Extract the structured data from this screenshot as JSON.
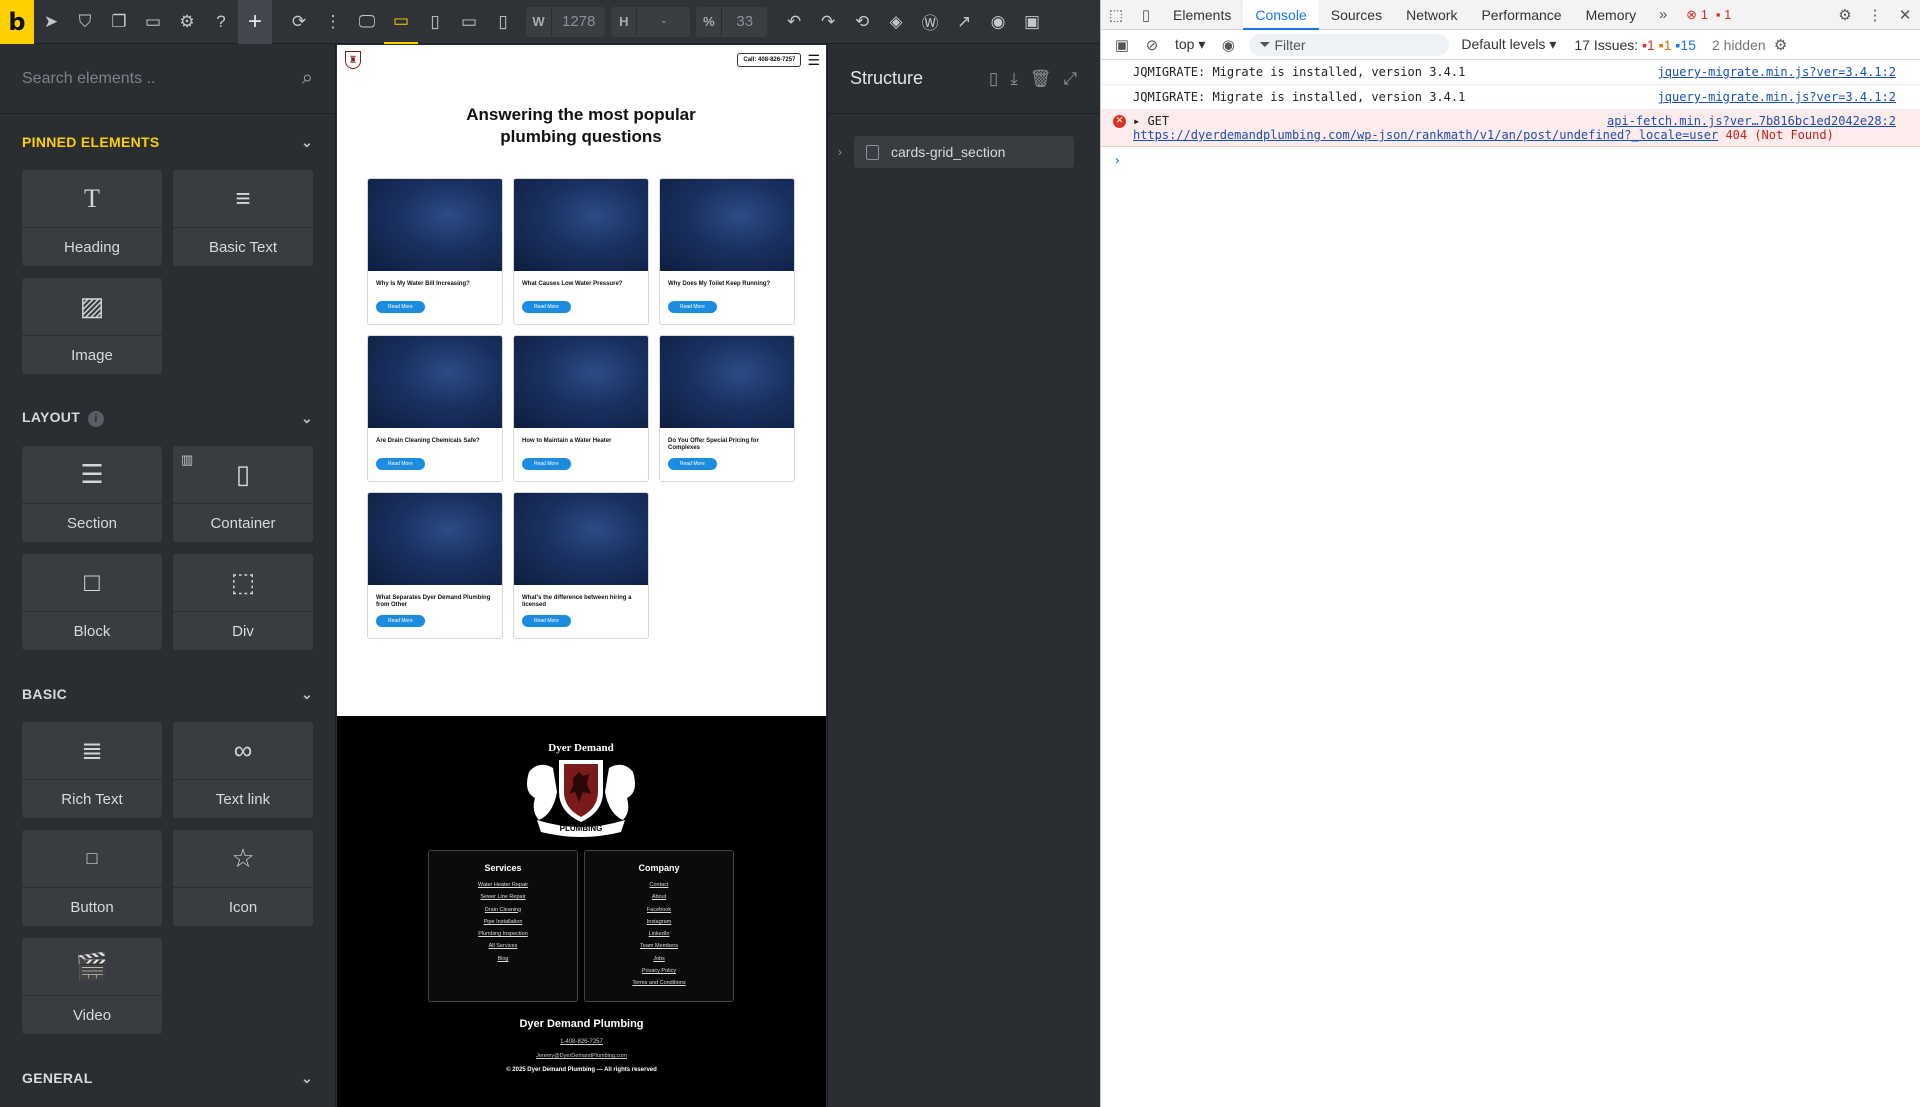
{
  "toolbar": {
    "logo": "b",
    "width_label": "W",
    "width_value": "1278",
    "height_label": "H",
    "height_value": "-",
    "zoom_label": "%",
    "zoom_value": "33"
  },
  "left_panel": {
    "search_placeholder": "Search elements ..",
    "categories": [
      {
        "title": "PINNED ELEMENTS",
        "items": [
          "Heading",
          "Basic Text",
          "Image"
        ]
      },
      {
        "title": "LAYOUT",
        "items": [
          "Section",
          "Container",
          "Block",
          "Div"
        ]
      },
      {
        "title": "BASIC",
        "items": [
          "Rich Text",
          "Text link",
          "Button",
          "Icon",
          "Video"
        ]
      },
      {
        "title": "GENERAL",
        "items": []
      }
    ]
  },
  "canvas": {
    "call_button": "Call: 408-826-7257",
    "section_title": "Answering the most popular plumbing questions",
    "read_more": "Read More",
    "cards": [
      "Why Is My Water Bill Increasing?",
      "What Causes Low Water Pressure?",
      "Why Does My Toilet Keep Running?",
      "Are Drain Cleaning Chemicals Safe?",
      "How to Maintain a Water Heater",
      "Do You Offer Special Pricing for Complexes",
      "What Separates Dyer Demand Plumbing from Other",
      "What's the difference between hiring a licensed"
    ],
    "footer": {
      "crest_name": "Dyer Demand",
      "crest_banner": "PLUMBING",
      "services_title": "Services",
      "services": [
        "Water Heater Repair",
        "Sewer Line Repair",
        "Drain Cleaning",
        "Pipe Installation",
        "Plumbing Inspection",
        "All Services",
        "Blog"
      ],
      "company_title": "Company",
      "company": [
        "Contact",
        "About",
        "Facebook",
        "Instagram",
        "LinkedIn",
        "Team Members",
        "Jobs",
        "Privacy Policy",
        "Terms and Conditions"
      ],
      "brand": "Dyer Demand Plumbing",
      "phone": "1-408-826-7257",
      "email": "Jeremy@DyerDemandPlumbing.com",
      "copyright": "© 2025 Dyer Demand Plumbing — All rights reserved"
    }
  },
  "structure": {
    "title": "Structure",
    "item": "cards-grid_section"
  },
  "devtools": {
    "tabs": [
      "Elements",
      "Console",
      "Sources",
      "Network",
      "Performance",
      "Memory"
    ],
    "selected_tab": "Console",
    "error_count": "1",
    "warning_count": "1",
    "context": "top",
    "filter_placeholder": "Filter",
    "levels": "Default levels",
    "issues_label": "17 Issues:",
    "issues_red": "1",
    "issues_orange": "1",
    "issues_blue": "15",
    "hidden": "2 hidden",
    "logs": [
      {
        "text": "JQMIGRATE: Migrate is installed, version 3.4.1",
        "source": "jquery-migrate.min.js?ver=3.4.1:2"
      },
      {
        "text": "JQMIGRATE: Migrate is installed, version 3.4.1",
        "source": "jquery-migrate.min.js?ver=3.4.1:2"
      }
    ],
    "error": {
      "method": "GET",
      "source": "api-fetch.min.js?ver…7b816bc1ed2042e28:2",
      "url": "https://dyerdemandplumbing.com/wp-json/rankmath/v1/an/post/undefined?_locale=user",
      "status": "404 (Not Found)"
    },
    "prompt": "›"
  }
}
